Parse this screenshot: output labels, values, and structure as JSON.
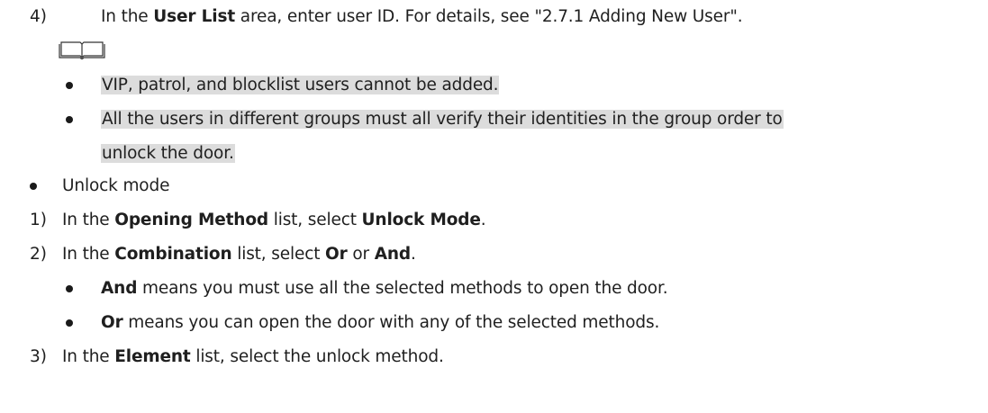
{
  "step4": {
    "num": "4)",
    "t1": "In the ",
    "b1": "User List",
    "t2": " area, enter user ID. For details, see \"2.7.1 Adding New User\"."
  },
  "note": {
    "icon": "book-note-icon",
    "items": [
      "VIP, patrol, and blocklist users cannot be added.",
      "All the users in different groups must all verify their identities in the group order to",
      "unlock the door."
    ]
  },
  "unlock_mode": {
    "label": "Unlock mode"
  },
  "step1": {
    "num": "1)",
    "t1": "In the ",
    "b1": "Opening Method",
    "t2": " list, select ",
    "b2": "Unlock Mode",
    "t3": "."
  },
  "step2": {
    "num": "2)",
    "t1": "In the ",
    "b1": "Combination",
    "t2": " list, select ",
    "b2": "Or",
    "t3": " or ",
    "b3": "And",
    "t4": "."
  },
  "sub_and": {
    "b": "And",
    "t": " means you must use all the selected methods to open the door."
  },
  "sub_or": {
    "b": "Or",
    "t": " means you can open the door with any of the selected methods."
  },
  "step3": {
    "num": "3)",
    "t1": "In the ",
    "b1": "Element",
    "t2": " list, select the unlock method."
  }
}
